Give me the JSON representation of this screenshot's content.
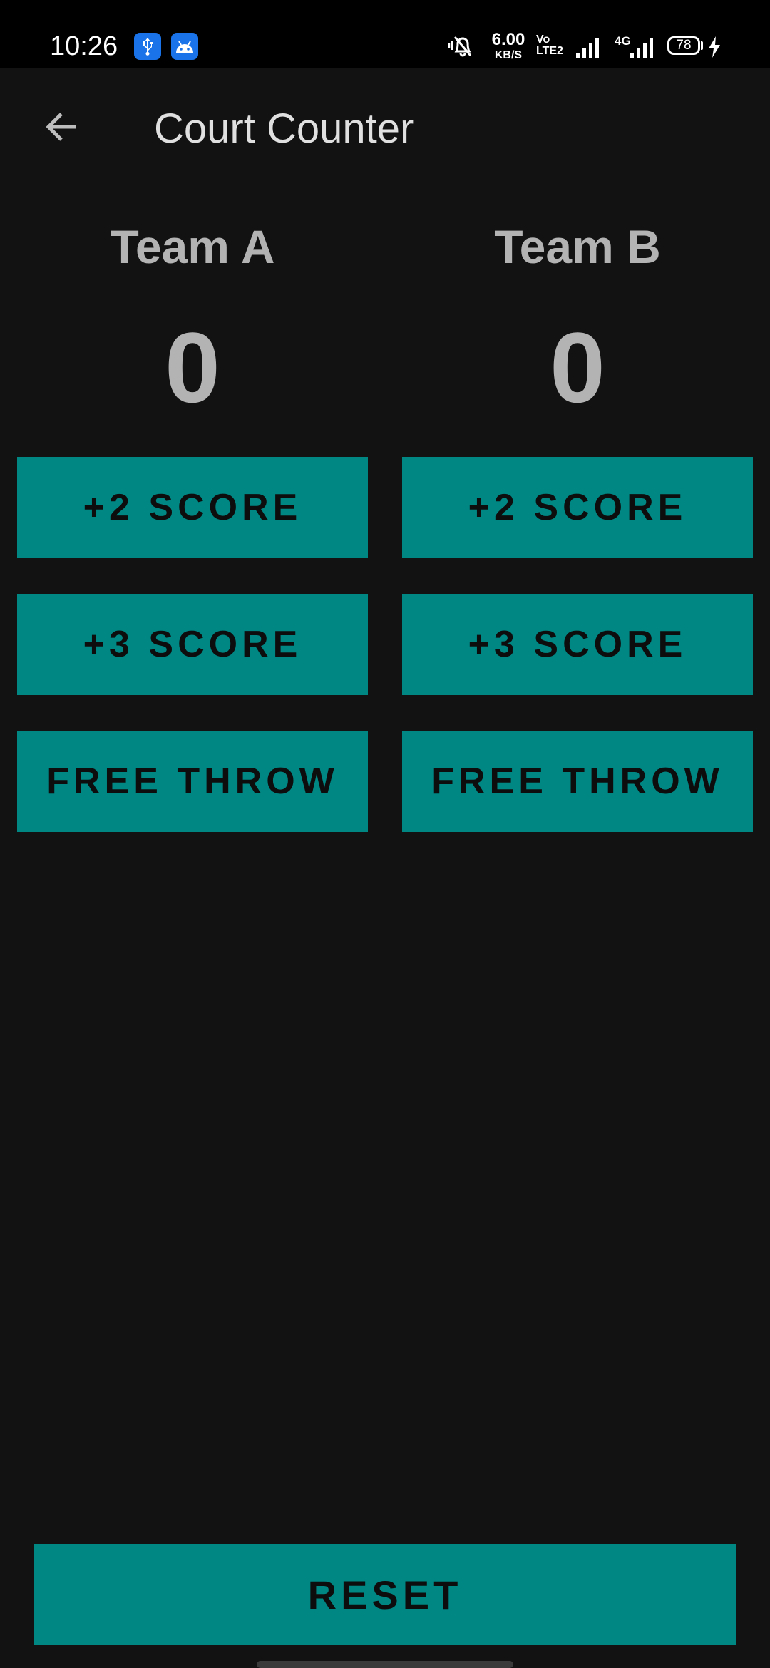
{
  "status_bar": {
    "time": "10:26",
    "notification_icons": [
      "usb-icon",
      "android-debug-icon"
    ],
    "network_speed_value": "6.00",
    "network_speed_unit": "KB/S",
    "volte_top": "Vo",
    "volte_bottom": "LTE2",
    "network_type": "4G",
    "battery_level": "78",
    "colors": {
      "background": "#000000",
      "badge": "#1a73e8"
    }
  },
  "app_bar": {
    "title": "Court Counter",
    "back_icon": "arrow-left-icon"
  },
  "teams": [
    {
      "name": "Team A",
      "score": "0",
      "buttons": {
        "two": "+2 SCORE",
        "three": "+3 SCORE",
        "free_throw": "FREE THROW"
      }
    },
    {
      "name": "Team B",
      "score": "0",
      "buttons": {
        "two": "+2 SCORE",
        "three": "+3 SCORE",
        "free_throw": "FREE THROW"
      }
    }
  ],
  "reset_label": "RESET",
  "colors": {
    "background": "#121212",
    "button": "#008784",
    "button_text": "#0d0d0d",
    "team_text": "#b3b3b3",
    "title_text": "#e0e0e0"
  }
}
